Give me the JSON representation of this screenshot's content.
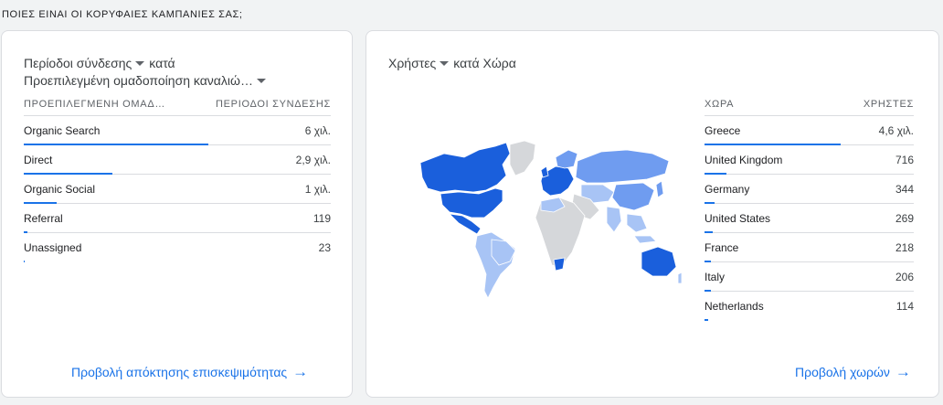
{
  "section_title": "ΠΟΙΕΣ ΕΙΝΑΙ ΟΙ ΚΟΡΥΦΑΙΕΣ ΚΑΜΠΑΝΙΕΣ ΣΑΣ;",
  "left_card": {
    "metric_label": "Περίοδοι σύνδεσης",
    "by_label": "κατά",
    "dimension_label": "Προεπιλεγμένη ομαδοποίηση καναλιώ…",
    "col_dimension": "ΠΡΟΕΠΙΛΕΓΜΕΝΗ ΟΜΑΔ…",
    "col_metric": "ΠΕΡΙΟΔΟΙ ΣΥΝΔΕΣΗΣ",
    "rows": [
      {
        "label": "Organic Search",
        "value": "6 χιλ.",
        "share": 1.0
      },
      {
        "label": "Direct",
        "value": "2,9 χιλ.",
        "share": 0.48
      },
      {
        "label": "Organic Social",
        "value": "1 χιλ.",
        "share": 0.18
      },
      {
        "label": "Referral",
        "value": "119",
        "share": 0.02
      },
      {
        "label": "Unassigned",
        "value": "23",
        "share": 0.005
      }
    ],
    "link_label": "Προβολή απόκτησης επισκεψιμότητας",
    "link_arrow": "→"
  },
  "right_card": {
    "metric_label": "Χρήστες",
    "by_label": "κατά Χώρα",
    "col_dimension": "ΧΩΡΑ",
    "col_metric": "ΧΡΗΣΤΕΣ",
    "rows": [
      {
        "label": "Greece",
        "value": "4,6 χιλ.",
        "share": 1.0
      },
      {
        "label": "United Kingdom",
        "value": "716",
        "share": 0.16
      },
      {
        "label": "Germany",
        "value": "344",
        "share": 0.075
      },
      {
        "label": "United States",
        "value": "269",
        "share": 0.06
      },
      {
        "label": "France",
        "value": "218",
        "share": 0.048
      },
      {
        "label": "Italy",
        "value": "206",
        "share": 0.045
      },
      {
        "label": "Netherlands",
        "value": "114",
        "share": 0.025
      }
    ],
    "link_label": "Προβολή χωρών",
    "link_arrow": "→"
  },
  "colors": {
    "accent": "#1a73e8",
    "map_dark": "#1a5fdc",
    "map_mid": "#6f9cf0",
    "map_light": "#a8c4f5",
    "map_none": "#d5d7da"
  }
}
